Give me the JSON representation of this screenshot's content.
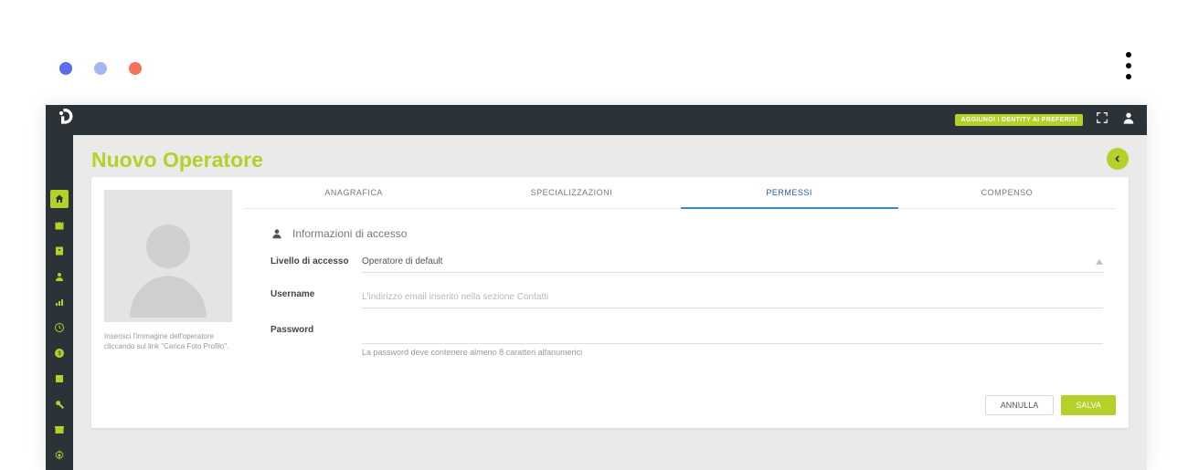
{
  "topbar": {
    "favorite_badge": "AGGIUNGI I DENTITY AI PREFERITI"
  },
  "page": {
    "title": "Nuovo Operatore"
  },
  "avatar": {
    "hint": "Inserisci l'immagine dell'operatore cliccando sul link \"Carica Foto Profilo\"."
  },
  "tabs": [
    {
      "label": "ANAGRAFICA",
      "active": false
    },
    {
      "label": "SPECIALIZZAZIONI",
      "active": false
    },
    {
      "label": "PERMESSI",
      "active": true
    },
    {
      "label": "COMPENSO",
      "active": false
    }
  ],
  "section": {
    "title": "Informazioni di accesso"
  },
  "fields": {
    "access_level": {
      "label": "Livello di accesso",
      "value": "Operatore di default"
    },
    "username": {
      "label": "Username",
      "placeholder": "L'indirizzo email inserito nella sezione Contatti",
      "value": ""
    },
    "password": {
      "label": "Password",
      "value": "",
      "hint": "La password deve contenere almeno 8 caratteri alfanumerici"
    }
  },
  "buttons": {
    "cancel": "ANNULLA",
    "save": "SALVA"
  }
}
